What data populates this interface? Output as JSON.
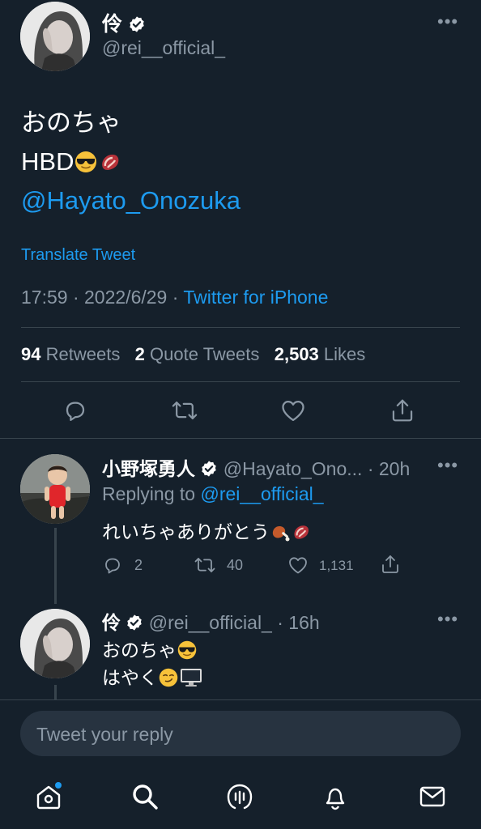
{
  "main_tweet": {
    "author_name": "伶",
    "author_handle": "@rei__official_",
    "text_line1": "おのちゃ",
    "text_line2": "HBD",
    "mention": "@Hayato_Onozuka",
    "translate": "Translate Tweet",
    "time": "17:59",
    "date": "2022/6/29",
    "source": "Twitter for iPhone",
    "sep": "·",
    "retweets_count": "94",
    "retweets_label": "Retweets",
    "quotes_count": "2",
    "quotes_label": "Quote Tweets",
    "likes_count": "2,503",
    "likes_label": "Likes",
    "more": "•••"
  },
  "reply1": {
    "author_name": "小野塚勇人",
    "author_handle": "@Hayato_Ono...",
    "age": "· 20h",
    "replying_prefix": "Replying to",
    "replying_to": "@rei__official_",
    "text": "れいちゃありがとう",
    "reply_count": "2",
    "retweet_count": "40",
    "like_count": "1,131",
    "more": "•••"
  },
  "reply2": {
    "author_name": "伶",
    "author_handle": "@rei__official_",
    "age": "· 16h",
    "text_line1": "おのちゃ",
    "text_line2": "はやく",
    "more": "•••"
  },
  "composer": {
    "placeholder": "Tweet your reply"
  },
  "colors": {
    "background": "#15202b",
    "accent": "#1d9bf0",
    "muted": "#8b98a5",
    "divider": "#38444d",
    "input_bg": "#273340"
  },
  "icons": [
    "reply-icon",
    "retweet-icon",
    "like-icon",
    "share-icon",
    "home-icon",
    "search-icon",
    "spaces-icon",
    "notifications-icon",
    "messages-icon",
    "verified-icon"
  ]
}
